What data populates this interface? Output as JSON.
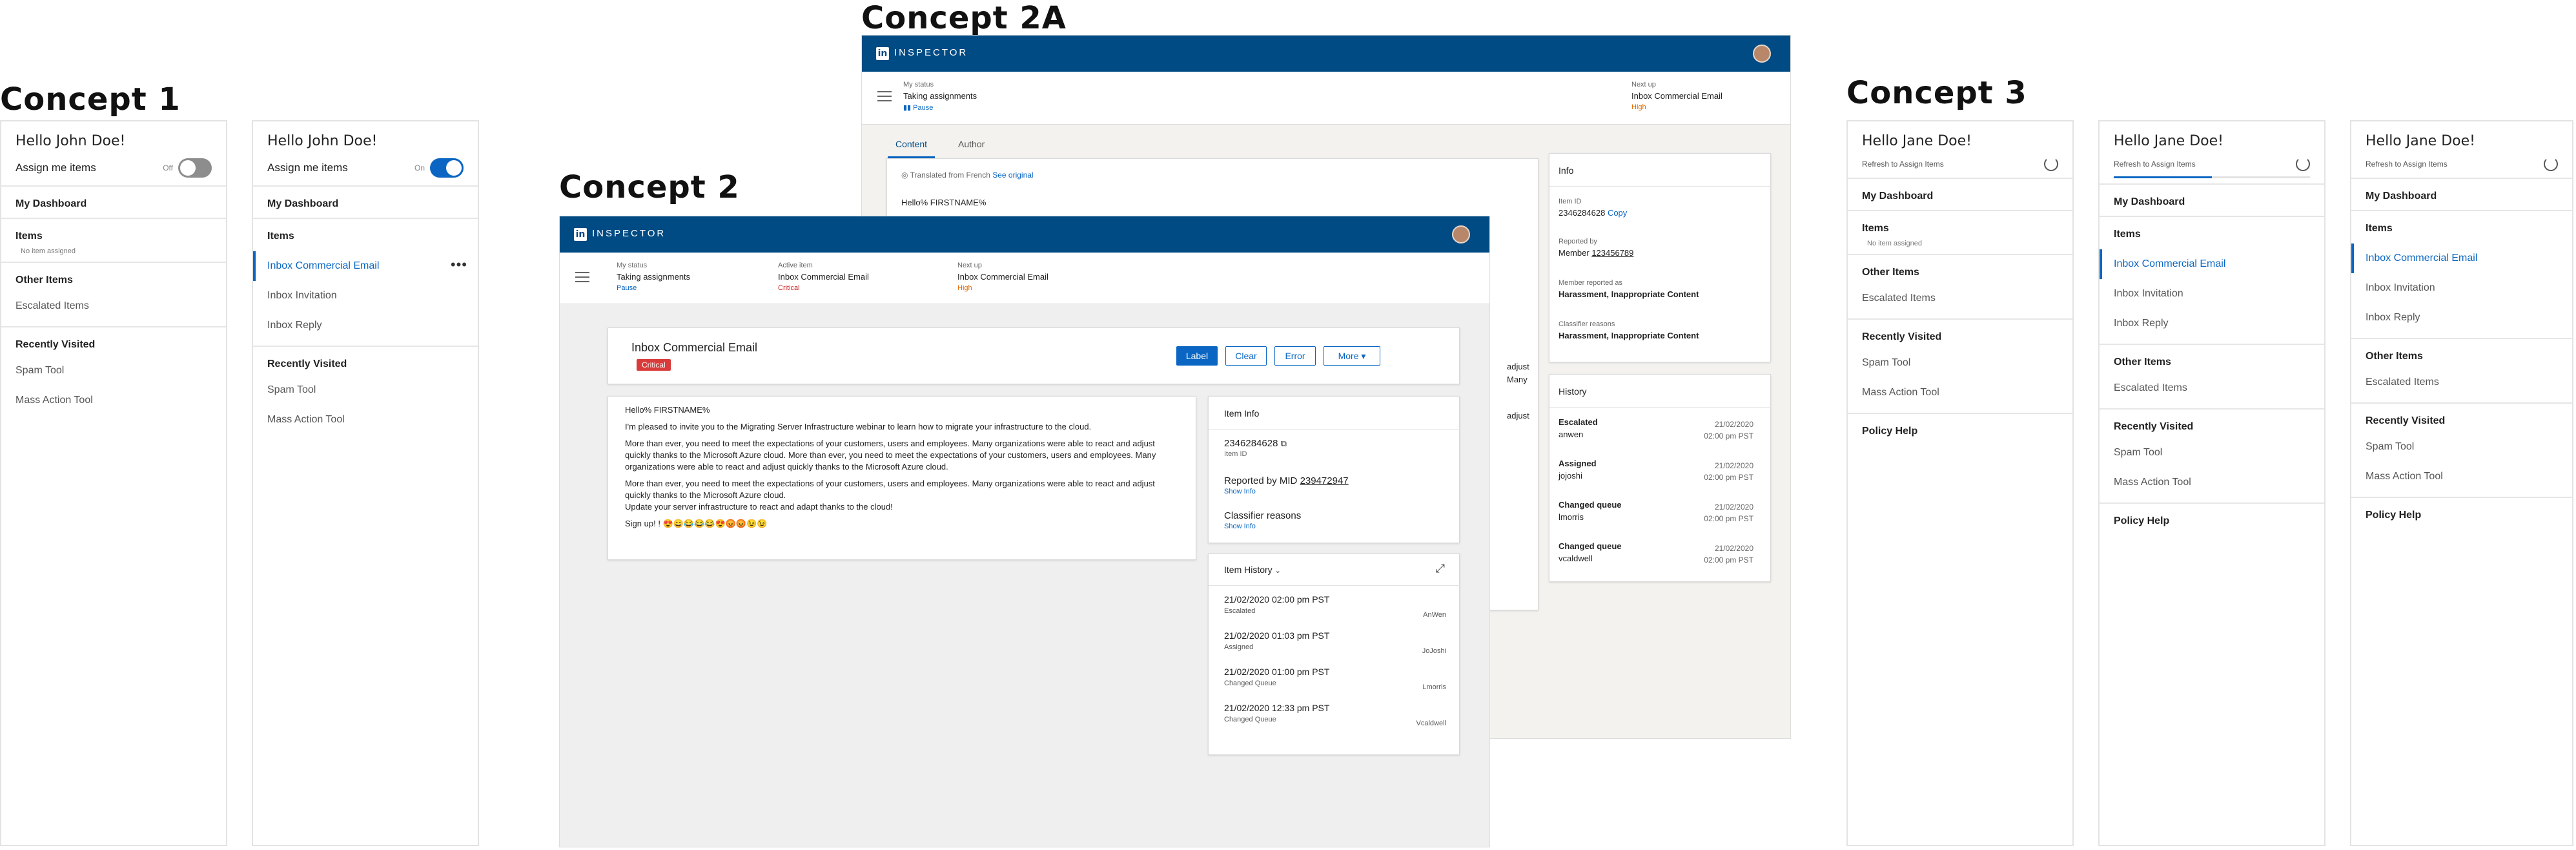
{
  "concepts": {
    "c1": "Concept 1",
    "c2": "Concept 2",
    "c2a": "Concept 2A",
    "c3": "Concept 3"
  },
  "concept1": {
    "panel_a": {
      "hello": "Hello John Doe!",
      "assign_label": "Assign me items",
      "toggle_state": "Off",
      "toggle_on": false,
      "dashboard": "My Dashboard",
      "items_heading": "Items",
      "no_item": "No item assigned",
      "other_heading": "Other Items",
      "other_items": [
        "Escalated Items"
      ],
      "recent_heading": "Recently Visited",
      "recent_items": [
        "Spam Tool",
        "Mass Action Tool"
      ]
    },
    "panel_b": {
      "hello": "Hello John Doe!",
      "assign_label": "Assign me items",
      "toggle_state": "On",
      "toggle_on": true,
      "dashboard": "My Dashboard",
      "items_heading": "Items",
      "items": [
        "Inbox Commercial Email",
        "Inbox Invitation",
        "Inbox Reply"
      ],
      "more": "•••",
      "recent_heading": "Recently Visited",
      "recent_items": [
        "Spam Tool",
        "Mass Action Tool"
      ]
    }
  },
  "inspector": {
    "logo_letter": "in",
    "brand": "INSPECTOR",
    "status_label": "My status",
    "status_value": "Taking assignments",
    "pause": "Pause",
    "active_label": "Active item",
    "active_value": "Inbox Commercial Email",
    "active_priority": "Critical",
    "next_label": "Next up",
    "next_value": "Inbox Commercial Email",
    "next_priority": "High"
  },
  "concept2": {
    "item_title": "Inbox Commercial Email",
    "item_badge": "Critical",
    "actions": [
      "Label",
      "Clear",
      "Error",
      "More ▾"
    ],
    "email": {
      "greeting": "Hello% FIRSTNAME%",
      "p1": "I'm pleased to invite you to the Migrating Server Infrastructure webinar to learn how to migrate your infrastructure to the cloud.",
      "p2": "More than ever, you need to meet the expectations of your customers, users and employees. Many organizations were able to react and adjust quickly thanks to the Microsoft Azure cloud. More than ever, you need to meet the expectations of your customers, users and employees. Many organizations were able to react and adjust quickly thanks to the Microsoft Azure cloud.",
      "p3": "More than ever, you need to meet the expectations of your customers, users and employees. Many organizations were able to react and adjust quickly thanks to the Microsoft Azure cloud.",
      "p4": "Update your server infrastructure to react and adapt thanks to the cloud!",
      "signup": "Sign up! ! 😍😄😂😂😂😍😡😡😉😉"
    },
    "item_info": {
      "title": "Item Info",
      "id_value": "2346284628",
      "id_label": "Item ID",
      "reported": "Reported by MID",
      "reported_mid": "239472947",
      "show_info": "Show Info",
      "classifier": "Classifier reasons",
      "show_info2": "Show Info"
    },
    "history": {
      "title": "Item History",
      "rows": [
        {
          "when": "21/02/2020 02:00 pm PST",
          "what": "Escalated",
          "who": "AnWen"
        },
        {
          "when": "21/02/2020 01:03 pm PST",
          "what": "Assigned",
          "who": "JoJoshi"
        },
        {
          "when": "21/02/2020 01:00 pm PST",
          "what": "Changed Queue",
          "who": "Lmorris"
        },
        {
          "when": "21/02/2020 12:33 pm PST",
          "what": "Changed Queue",
          "who": "Vcaldwell"
        }
      ]
    }
  },
  "concept2a": {
    "tabs": [
      "Content",
      "Author"
    ],
    "translated": "Translated from French",
    "see_original": "See original",
    "greeting": "Hello% FIRSTNAME%",
    "peek": [
      "adjust",
      "Many",
      "adjust"
    ],
    "info": {
      "title": "Info",
      "item_id_label": "Item ID",
      "item_id": "2346284628",
      "copy": "Copy",
      "reported_label": "Reported by",
      "reported_prefix": "Member",
      "reported_value": "123456789",
      "member_label": "Member reported as",
      "member_value": "Harassment, Inappropriate Content",
      "classifier_label": "Classifier reasons",
      "classifier_value": "Harassment, Inappropriate Content"
    },
    "history": {
      "title": "History",
      "rows": [
        {
          "action": "Escalated",
          "user": "anwen",
          "date": "21/02/2020",
          "time": "02:00 pm PST"
        },
        {
          "action": "Assigned",
          "user": "jojoshi",
          "date": "21/02/2020",
          "time": "02:00 pm PST"
        },
        {
          "action": "Changed queue",
          "user": "lmorris",
          "date": "21/02/2020",
          "time": "02:00 pm PST"
        },
        {
          "action": "Changed queue",
          "user": "vcaldwell",
          "date": "21/02/2020",
          "time": "02:00 pm PST"
        }
      ]
    }
  },
  "concept3": {
    "panels": [
      {
        "hello": "Hello Jane Doe!",
        "refresh": "Refresh to Assign Items",
        "progress": 0,
        "dashboard": "My Dashboard",
        "items_heading": "Items",
        "no_item": "No item assigned",
        "items": [],
        "other_heading": "Other Items",
        "other_items": [
          "Escalated Items"
        ],
        "recent_heading": "Recently Visited",
        "recent_items": [
          "Spam Tool",
          "Mass Action Tool"
        ],
        "policy": "Policy Help"
      },
      {
        "hello": "Hello Jane Doe!",
        "refresh": "Refresh to Assign Items",
        "progress": 0.5,
        "dashboard": "My Dashboard",
        "items_heading": "Items",
        "no_item": "",
        "items": [
          "Inbox Commercial Email",
          "Inbox Invitation",
          "Inbox Reply"
        ],
        "other_heading": "Other Items",
        "other_items": [
          "Escalated Items"
        ],
        "recent_heading": "Recently Visited",
        "recent_items": [
          "Spam Tool",
          "Mass Action Tool"
        ],
        "policy": "Policy Help"
      },
      {
        "hello": "Hello Jane Doe!",
        "refresh": "Refresh to Assign Items",
        "progress": 0,
        "dashboard": "My Dashboard",
        "items_heading": "Items",
        "no_item": "",
        "items": [
          "Inbox Commercial Email",
          "Inbox Invitation",
          "Inbox Reply"
        ],
        "other_heading": "Other Items",
        "other_items": [
          "Escalated Items"
        ],
        "recent_heading": "Recently Visited",
        "recent_items": [
          "Spam Tool",
          "Mass Action Tool"
        ],
        "policy": "Policy Help"
      }
    ]
  },
  "colors": {
    "brand": "#004b84",
    "accent": "#0a66c2",
    "critical": "#d93a3a",
    "high": "#e06a00"
  }
}
